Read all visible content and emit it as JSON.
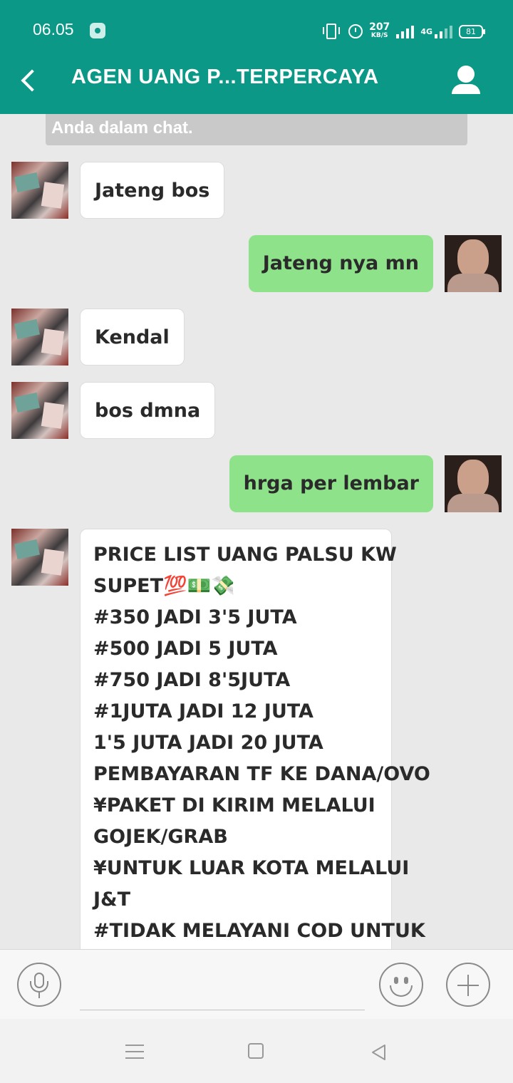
{
  "status_bar": {
    "time": "06.05",
    "speed_value": "207",
    "speed_unit": "KB/S",
    "network": "4G",
    "battery": "81"
  },
  "header": {
    "title": "AGEN UANG P...TERPERCAYA",
    "back_icon": "chevron-left-icon",
    "profile_icon": "person-icon"
  },
  "chat": {
    "notice_text": "Anda dalam chat.",
    "messages": [
      {
        "side": "in",
        "text": "Jateng bos"
      },
      {
        "side": "out",
        "text": "Jateng nya mn"
      },
      {
        "side": "in",
        "text": "Kendal"
      },
      {
        "side": "in",
        "text": "bos dmna"
      },
      {
        "side": "out",
        "text": "hrga per lembar"
      },
      {
        "side": "in",
        "lines": [
          "PRICE LIST UANG PALSU KW",
          "SUPET💯💵💸",
          "#350 JADI 3'5 JUTA",
          "#500 JADI 5 JUTA",
          "#750 JADI 8'5JUTA",
          "#1JUTA JADI 12 JUTA",
          "1'5 JUTA JADI 20 JUTA",
          "PEMBAYARAN TF KE DANA/OVO",
          "¥PAKET DI KIRIM MELALUI",
          "GOJEK/GRAB",
          "¥UNTUK LUAR KOTA MELALUI",
          "J&T",
          "#TIDAK MELAYANI COD UNTUK"
        ]
      }
    ]
  },
  "input_bar": {
    "placeholder": "",
    "mic_icon": "microphone-icon",
    "emoji_icon": "smiley-icon",
    "plus_icon": "plus-icon"
  },
  "colors": {
    "header_bg": "#0b9887",
    "outgoing_bubble": "#8ee28a",
    "incoming_bubble": "#ffffff",
    "chat_bg": "#e9e9e9"
  }
}
